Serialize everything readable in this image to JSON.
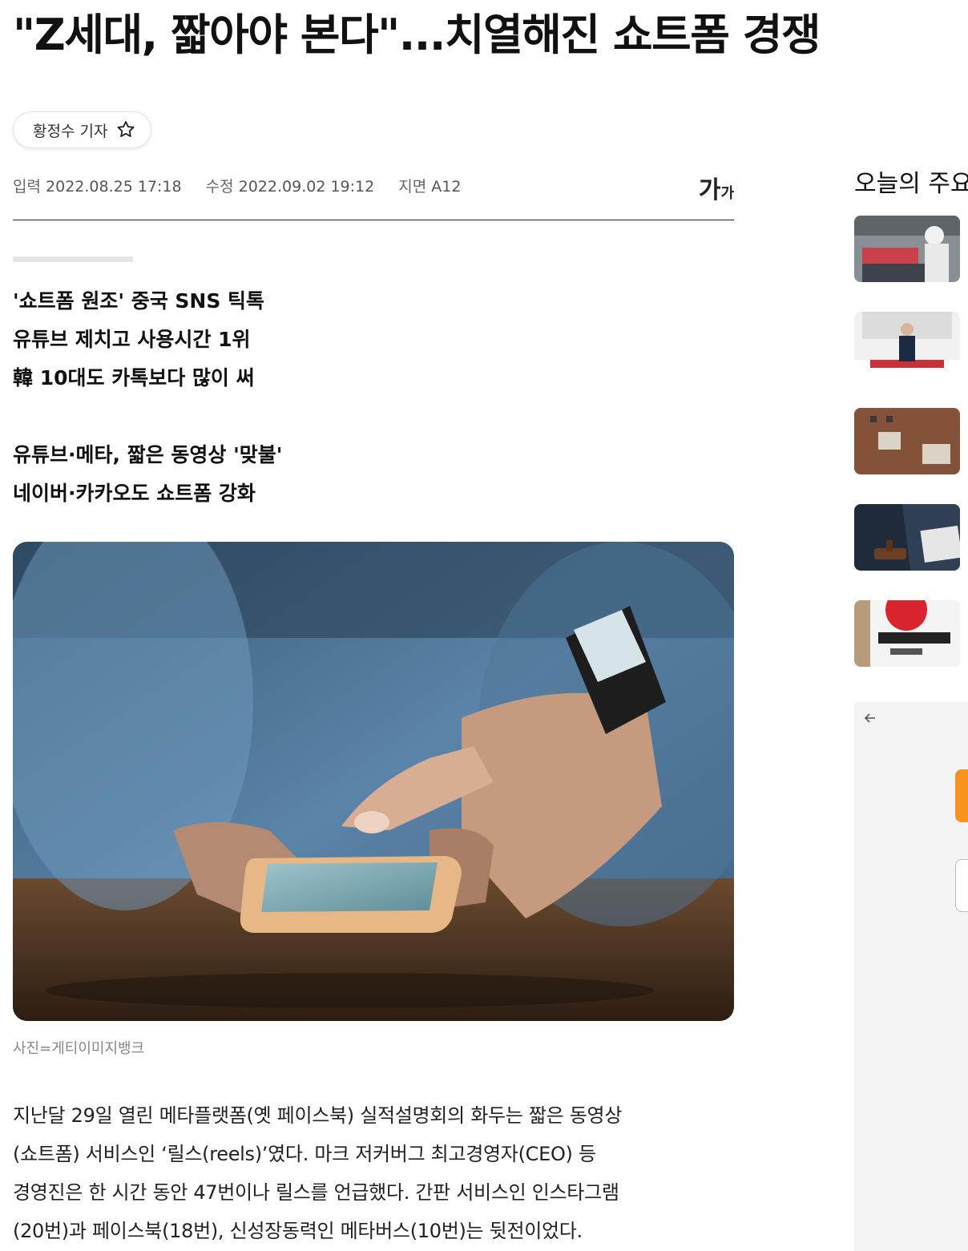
{
  "article": {
    "headline": "\"Z세대, 짧아야 본다\"...치열해진 쇼트폼 경쟁",
    "reporter": "황정수 기자",
    "meta": {
      "input_label": "입력",
      "input_date": "2022.08.25 17:18",
      "modified_label": "수정",
      "modified_date": "2022.09.02 19:12",
      "page_label": "지면",
      "page_value": "A12"
    },
    "font_size_button": {
      "large": "가",
      "small": "가"
    },
    "subtitles_group1": [
      "'쇼트폼 원조' 중국 SNS 틱톡",
      "유튜브 제치고 사용시간 1위",
      "韓 10대도 카톡보다 많이 써"
    ],
    "subtitles_group2": [
      "유튜브·메타, 짧은 동영상 '맞불'",
      "네이버·카카오도 쇼트폼 강화"
    ],
    "photo_caption": "사진=게티이미지뱅크",
    "body_lines": [
      "지난달 29일 열린 메타플랫폼(옛 페이스북) 실적설명회의 화두는 짧은 동영상",
      "(쇼트폼) 서비스인 ‘릴스(reels)’였다. 마크 저커버그 최고경영자(CEO) 등",
      "경영진은 한 시간 동안 47번이나 릴스를 언급했다. 간판 서비스인 인스타그램",
      "(20번)과 페이스북(18번), 신성장동력인 메타버스(10번)는 뒷전이었다."
    ]
  },
  "sidebar": {
    "title": "오늘의 주요"
  },
  "icons": {
    "star": "star-outline-icon",
    "back": "arrow-left-icon"
  },
  "colors": {
    "accent_orange": "#f7931e",
    "text_dark": "#111111",
    "meta_gray": "#666666"
  }
}
